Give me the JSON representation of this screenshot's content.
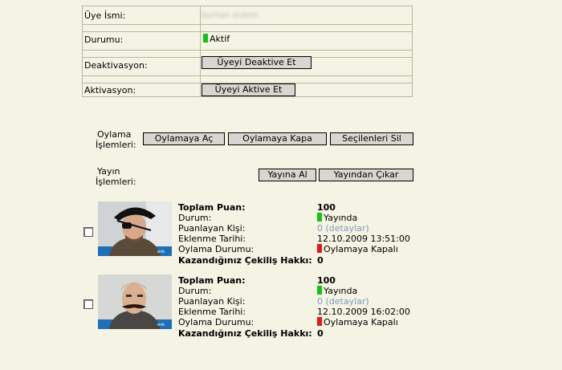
{
  "member": {
    "name_label": "Üye İsmi:",
    "name_value": "burhan erdem",
    "status_label": "Durumu:",
    "status_value": "Aktif",
    "deactivation_label": "Deaktivasyon:",
    "deactivate_button": "Üyeyi Deaktive Et",
    "activation_label": "Aktivasyon:",
    "activate_button": "Üyeyi Aktive Et"
  },
  "voting_ops": {
    "label_line1": "Oylama",
    "label_line2": "İşlemleri:",
    "open_button": "Oylamaya Aç",
    "close_button": "Oylamaya Kapa",
    "delete_button": "Seçilenleri Sil"
  },
  "publish_ops": {
    "label_line1": "Yayın",
    "label_line2": "İşlemleri:",
    "publish_button": "Yayına Al",
    "unpublish_button": "Yayından Çıkar"
  },
  "entries": [
    {
      "total_label": "Toplam Puan:",
      "total_value": "100",
      "status_label": "Durum:",
      "status_value": "Yayında",
      "raters_label": "Puanlayan Kişi:",
      "raters_value": "0 (detaylar)",
      "date_label": "Eklenme Tarihi:",
      "date_value": "12.10.2009 13:51:00",
      "vote_label": "Oylama Durumu:",
      "vote_value": "Oylamaya Kapalı",
      "draw_label": "Kazandığınız Çekiliş Hakkı:",
      "draw_value": "0"
    },
    {
      "total_label": "Toplam Puan:",
      "total_value": "100",
      "status_label": "Durum:",
      "status_value": "Yayında",
      "raters_label": "Puanlayan Kişi:",
      "raters_value": "0 (detaylar)",
      "date_label": "Eklenme Tarihi:",
      "date_value": "12.10.2009 16:02:00",
      "vote_label": "Oylama Durumu:",
      "vote_value": "Oylamaya Kapalı",
      "draw_label": "Kazandığınız Çekiliş Hakkı:",
      "draw_value": "0"
    }
  ],
  "colors": {
    "active": "#13c313",
    "closed": "#e01b1b",
    "link": "#7a9dbf",
    "background": "#f5f3e3"
  }
}
